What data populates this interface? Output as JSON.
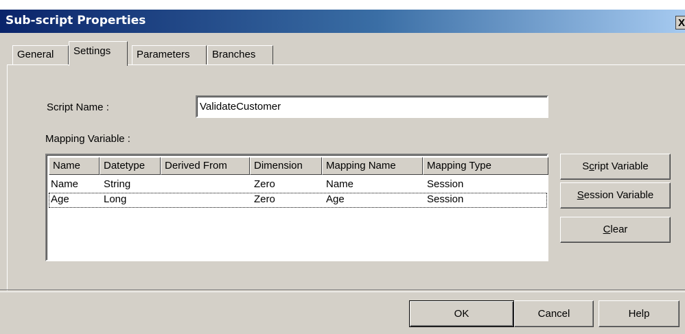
{
  "window": {
    "title": "Sub-script Properties",
    "close_glyph": "X"
  },
  "tabs": [
    {
      "label": "General",
      "active": false
    },
    {
      "label": "Settings",
      "active": true
    },
    {
      "label": "Parameters",
      "active": false
    },
    {
      "label": "Branches",
      "active": false
    }
  ],
  "form": {
    "script_name_label": "Script Name :",
    "script_name_value": "ValidateCustomer",
    "mapping_label": "Mapping Variable :"
  },
  "table": {
    "columns": [
      "Name",
      "Datetype",
      "Derived From",
      "Dimension",
      "Mapping Name",
      "Mapping Type"
    ],
    "rows": [
      [
        "Name",
        "String",
        "",
        "Zero",
        "Name",
        "Session"
      ],
      [
        "Age",
        "Long",
        "",
        "Zero",
        "Age",
        "Session"
      ]
    ]
  },
  "side_buttons": {
    "script_variable": {
      "pre": "S",
      "u": "c",
      "post": "ript Variable"
    },
    "session_variable": {
      "pre": "",
      "u": "S",
      "post": "ession Variable"
    },
    "clear": {
      "pre": "",
      "u": "C",
      "post": "lear"
    }
  },
  "footer": {
    "ok": "OK",
    "cancel": "Cancel",
    "help": "Help"
  }
}
